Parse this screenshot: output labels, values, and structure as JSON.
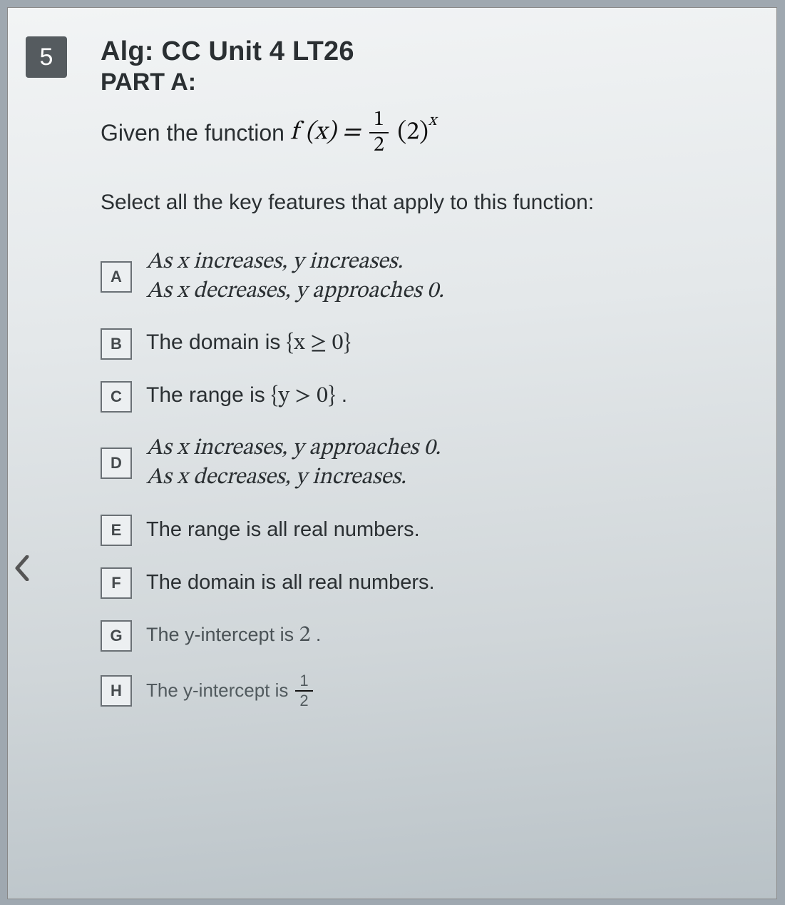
{
  "question_number": "5",
  "title": "Alg: CC Unit 4 LT26",
  "part_label": "PART A:",
  "stem_lead": "Given the function",
  "func_left": "f (x) =",
  "frac_num": "1",
  "frac_den": "2",
  "base": "(2)",
  "exponent": "x",
  "instruction": "Select all the key features that apply to this function:",
  "options": {
    "A": {
      "letter": "A",
      "line1": "As x increases, y increases.",
      "line2": "As x decreases, y approaches 0."
    },
    "B": {
      "letter": "B",
      "pre": "The domain is ",
      "set": "{x ≥ 0}"
    },
    "C": {
      "letter": "C",
      "pre": "The range is ",
      "set": "{y > 0}",
      "post": " ."
    },
    "D": {
      "letter": "D",
      "line1": "As x increases, y approaches 0.",
      "line2": "As x decreases, y increases."
    },
    "E": {
      "letter": "E",
      "text": "The range is all real numbers."
    },
    "F": {
      "letter": "F",
      "text": "The domain is all real numbers."
    },
    "G": {
      "letter": "G",
      "pre": "The y-intercept is ",
      "val": "2",
      "post": " ."
    },
    "H": {
      "letter": "H",
      "pre": "The y-intercept is ",
      "frac_num": "1",
      "frac_den": "2"
    }
  }
}
